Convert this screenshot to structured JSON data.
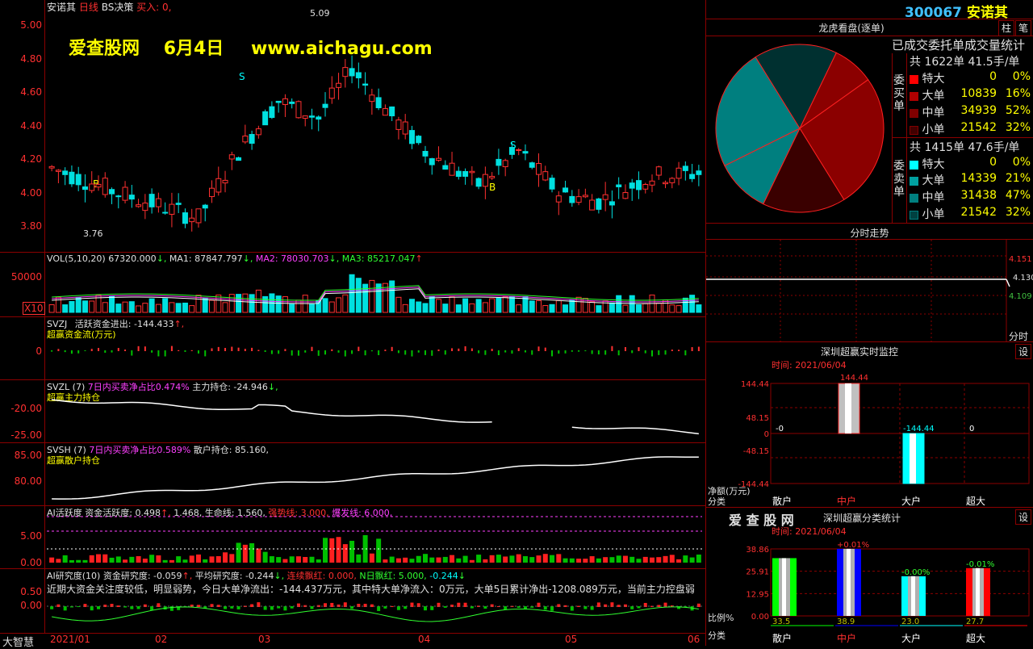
{
  "stock": {
    "code": "300067",
    "name": "安诺其"
  },
  "main_header": {
    "name": "安诺其",
    "period": "日线",
    "strategy": "BS决策",
    "signal": "买入: 0,"
  },
  "watermark": {
    "site": "爱查股网",
    "date": "6月4日",
    "url": "www.aichagu.com"
  },
  "price_chart": {
    "y_labels": [
      "5.00",
      "4.80",
      "4.60",
      "4.40",
      "4.20",
      "4.00",
      "3.80"
    ],
    "high_label": "5.09",
    "low_label": "3.76",
    "signals": [
      {
        "label": "B"
      },
      {
        "label": "S"
      },
      {
        "label": "S"
      },
      {
        "label": "B"
      }
    ]
  },
  "vol_panel": {
    "title": "VOL(5,10,20)",
    "value": "67320.000",
    "ma1": "MA1: 87847.797",
    "ma2": "MA2: 78030.703",
    "ma3": "MA3: 85217.047",
    "y_label": "50000",
    "unit": "X10"
  },
  "svzj_panel": {
    "title": "SVZJ",
    "desc": "活跃资金进出: -144.433",
    "sub": "超赢资金流(万元)",
    "y_label": "0"
  },
  "svzl_panel": {
    "title": "SVZL (7)",
    "ratio": "7日内买卖净占比0.474%",
    "desc": "主力持仓: -24.946",
    "sub": "超赢主力持仓",
    "y_labels": [
      "-20.00",
      "-25.00"
    ]
  },
  "svsh_panel": {
    "title": "SVSH (7)",
    "ratio": "7日内买卖净占比0.589%",
    "desc": "散户持仓: 85.160,",
    "sub": "超赢散户持仓",
    "y_labels": [
      "85.00",
      "80.00"
    ]
  },
  "ai_active_panel": {
    "title": "AI活跃度",
    "fund": "资金活跃度: 0.498",
    "v2": "1.468,",
    "life": "生命线: 1.560,",
    "strong": "强势线: 3.000,",
    "burst": "爆发线: 6.000,",
    "y_labels": [
      "5.00",
      "0.00"
    ]
  },
  "ai_research_panel": {
    "title": "AI研究度(10)",
    "fund": "资金研究度: -0.059",
    "avg": "平均研究度: -0.244",
    "red": "连续飘红: 0.000,",
    "nred": "N日飘红: 5.000,",
    "last": "-0.244",
    "comment": "近期大资金关注度较低，明显弱势，今日大单净流出：-144.437万元，其中特大单净流入：0万元，大单5日累计净出-1208.089万元，当前主力控盘弱",
    "y_labels": [
      "0.50",
      "0.00"
    ]
  },
  "bottom_axis": {
    "brand": "大智慧",
    "dates": [
      "2021/01",
      "02",
      "03",
      "04",
      "05",
      "06"
    ]
  },
  "right_panel": {
    "btn_pillar": "柱",
    "btn_note": "笔",
    "tiger_title": "龙虎看盘(逐单)",
    "stat_title": "已成交委托单成交量统计",
    "buy": {
      "side_label": "委买单",
      "total": "共 1622单 41.5手/单",
      "rows": [
        {
          "name": "特大",
          "count": "0",
          "pct": "0%",
          "color": "#ff0000"
        },
        {
          "name": "大单",
          "count": "10839",
          "pct": "16%",
          "color": "#b00000"
        },
        {
          "name": "中单",
          "count": "34939",
          "pct": "52%",
          "color": "#800000"
        },
        {
          "name": "小单",
          "count": "21542",
          "pct": "32%",
          "color": "#400000"
        }
      ]
    },
    "sell": {
      "side_label": "委卖单",
      "total": "共 1415单 47.6手/单",
      "rows": [
        {
          "name": "特大",
          "count": "0",
          "pct": "0%",
          "color": "#00ffff"
        },
        {
          "name": "大单",
          "count": "14339",
          "pct": "21%",
          "color": "#00a0a0"
        },
        {
          "name": "中单",
          "count": "31438",
          "pct": "47%",
          "color": "#007f7f"
        },
        {
          "name": "小单",
          "count": "21542",
          "pct": "32%",
          "color": "#004040"
        }
      ]
    },
    "pie": [
      {
        "name": "买大单",
        "value": 16,
        "color": "#8b0000"
      },
      {
        "name": "买中单",
        "value": 52,
        "color": "#8b0000"
      },
      {
        "name": "买小单",
        "value": 32,
        "color": "#3a0000"
      },
      {
        "name": "卖大单",
        "value": 21,
        "color": "#007f7f"
      },
      {
        "name": "卖中单",
        "value": 47,
        "color": "#007f7f"
      },
      {
        "name": "卖小单",
        "value": 32,
        "color": "#003030"
      }
    ],
    "intraday": {
      "title": "分时走势",
      "prices": [
        "4.151",
        "4.130",
        "4.109"
      ],
      "label": "分时"
    },
    "monitor": {
      "title": "深圳超赢实时监控",
      "btn": "设",
      "time": "时间: 2021/06/04",
      "y_labels": [
        "144.44",
        "48.15",
        "0",
        "-48.15",
        "-144.44"
      ],
      "unit": "净额(万元)",
      "axis_label": "分类",
      "categories": [
        "散户",
        "中户",
        "大户",
        "超大"
      ],
      "values": [
        "-0",
        "144.44",
        "-144.44",
        "0"
      ]
    },
    "classify": {
      "logo": "爱 查 股 网",
      "title": "深圳超赢分类统计",
      "btn": "设",
      "time": "时间: 2021/06/04",
      "y_labels": [
        "38.86",
        "25.91",
        "12.95",
        "0.00"
      ],
      "ratio_label": "比例%",
      "axis_label": "分类",
      "categories": [
        "散户",
        "中户",
        "大户",
        "超大"
      ],
      "values": [
        "33.5",
        "38.9",
        "23.0",
        "27.7"
      ],
      "changes": [
        "",
        "+0.01%",
        "-0.00%",
        "-0.01%"
      ],
      "colors": [
        "#00ff00",
        "#0000ff",
        "#00ffff",
        "#ff0000"
      ]
    }
  }
}
